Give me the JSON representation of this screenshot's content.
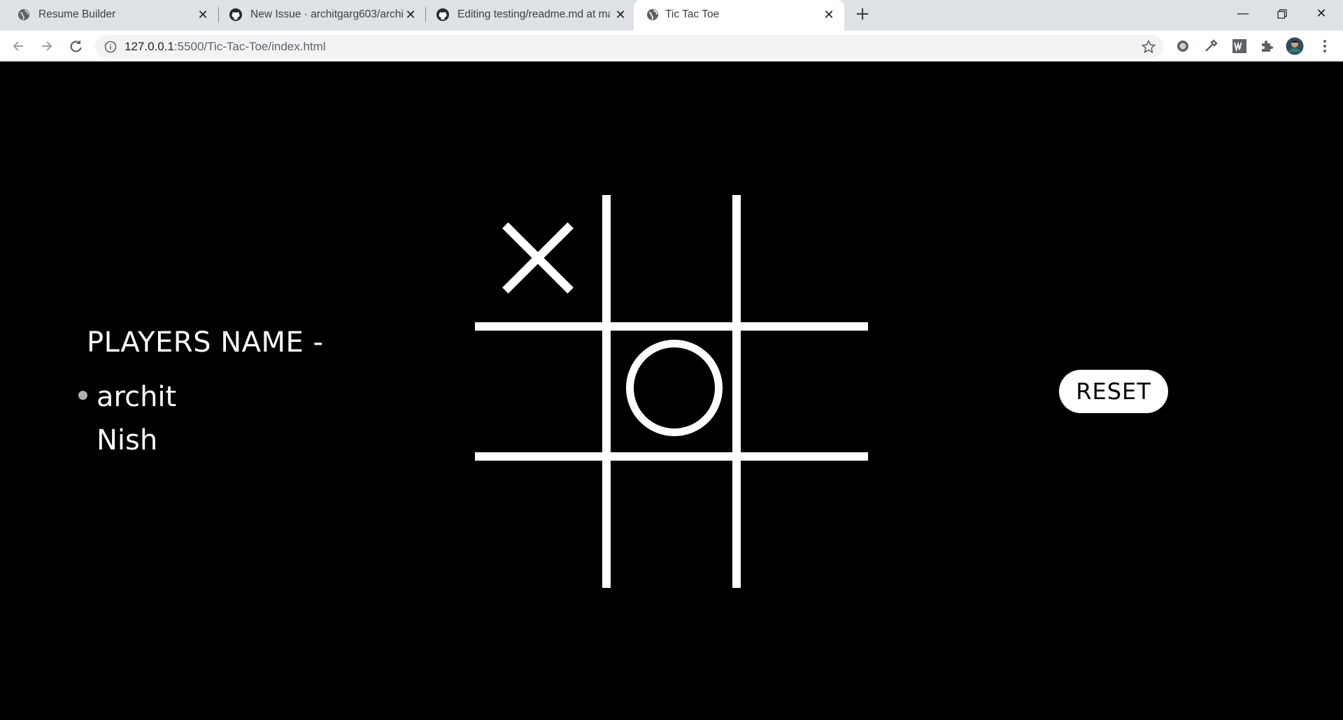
{
  "browser": {
    "tabs": [
      {
        "title": "Resume Builder",
        "icon": "globe-icon",
        "active": false
      },
      {
        "title": "New Issue · architgarg603/architg",
        "icon": "github-icon",
        "active": false
      },
      {
        "title": "Editing testing/readme.md at ma",
        "icon": "github-icon",
        "active": false
      },
      {
        "title": "Tic Tac Toe",
        "icon": "globe-icon",
        "active": true
      }
    ],
    "url_host": "127.0.0.1",
    "url_rest": ":5500/Tic-Tac-Toe/index.html",
    "colors": {
      "tabstrip": "#dee1e6",
      "toolbar": "#ffffff",
      "omnibox": "#f1f3f4"
    }
  },
  "game": {
    "players_title": "PLAYERS NAME -",
    "players": [
      {
        "name": "archit",
        "current": true
      },
      {
        "name": "Nish",
        "current": false
      }
    ],
    "board": [
      "X",
      "",
      "",
      "",
      "O",
      "",
      "",
      "",
      ""
    ],
    "reset_label": "RESET",
    "colors": {
      "background": "#000000",
      "foreground": "#ffffff"
    }
  }
}
